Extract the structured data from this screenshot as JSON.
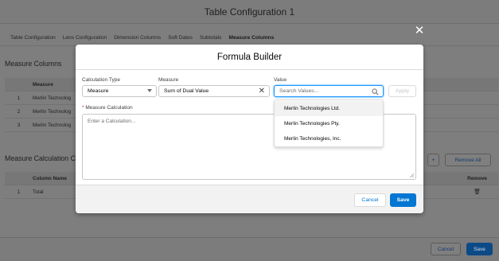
{
  "page": {
    "title": "Table Configuration 1",
    "tabs": [
      {
        "label": "Table Configuration",
        "active": false
      },
      {
        "label": "Lens Configuration",
        "active": false
      },
      {
        "label": "Dimension Columns",
        "active": false
      },
      {
        "label": "Soft Dates",
        "active": false
      },
      {
        "label": "Subtotals",
        "active": false
      },
      {
        "label": "Measure Columns",
        "active": true
      }
    ],
    "measure_columns": {
      "title": "Measure Columns",
      "header": {
        "name": "Measure"
      },
      "rows": [
        {
          "num": "1",
          "name": "Merlin Technolog"
        },
        {
          "num": "2",
          "name": "Merlin Technolog"
        },
        {
          "num": "3",
          "name": "Merlin Technolog"
        }
      ]
    },
    "measure_calc": {
      "title": "Measure Calculation Co",
      "header": {
        "name": "Column Name",
        "remove": "Remove"
      },
      "rows": [
        {
          "num": "1",
          "name": "Total"
        }
      ],
      "add_label": "+",
      "remove_all_label": "Remove All"
    },
    "footer": {
      "cancel": "Cancel",
      "save": "Save"
    }
  },
  "modal": {
    "title": "Formula Builder",
    "close_icon": "close-icon",
    "calculation_type": {
      "label": "Calculation Type",
      "value": "Measure"
    },
    "measure": {
      "label": "Measure",
      "value": "Sum of Dual Value"
    },
    "value": {
      "label": "Value",
      "placeholder": "Search Values..."
    },
    "apply_label": "Apply",
    "measure_calculation": {
      "label": "Measure Calculation",
      "required_mark": "*",
      "placeholder": "Enter a Calculation..."
    },
    "options": [
      "Merlin Technologies Ltd.",
      "Merlin Technologies Pty.",
      "Merlin Technologies, Inc."
    ],
    "cancel_label": "Cancel",
    "save_label": "Save"
  },
  "colors": {
    "brand": "#0176d3",
    "focus": "#1b96ff",
    "required": "#c23934"
  }
}
